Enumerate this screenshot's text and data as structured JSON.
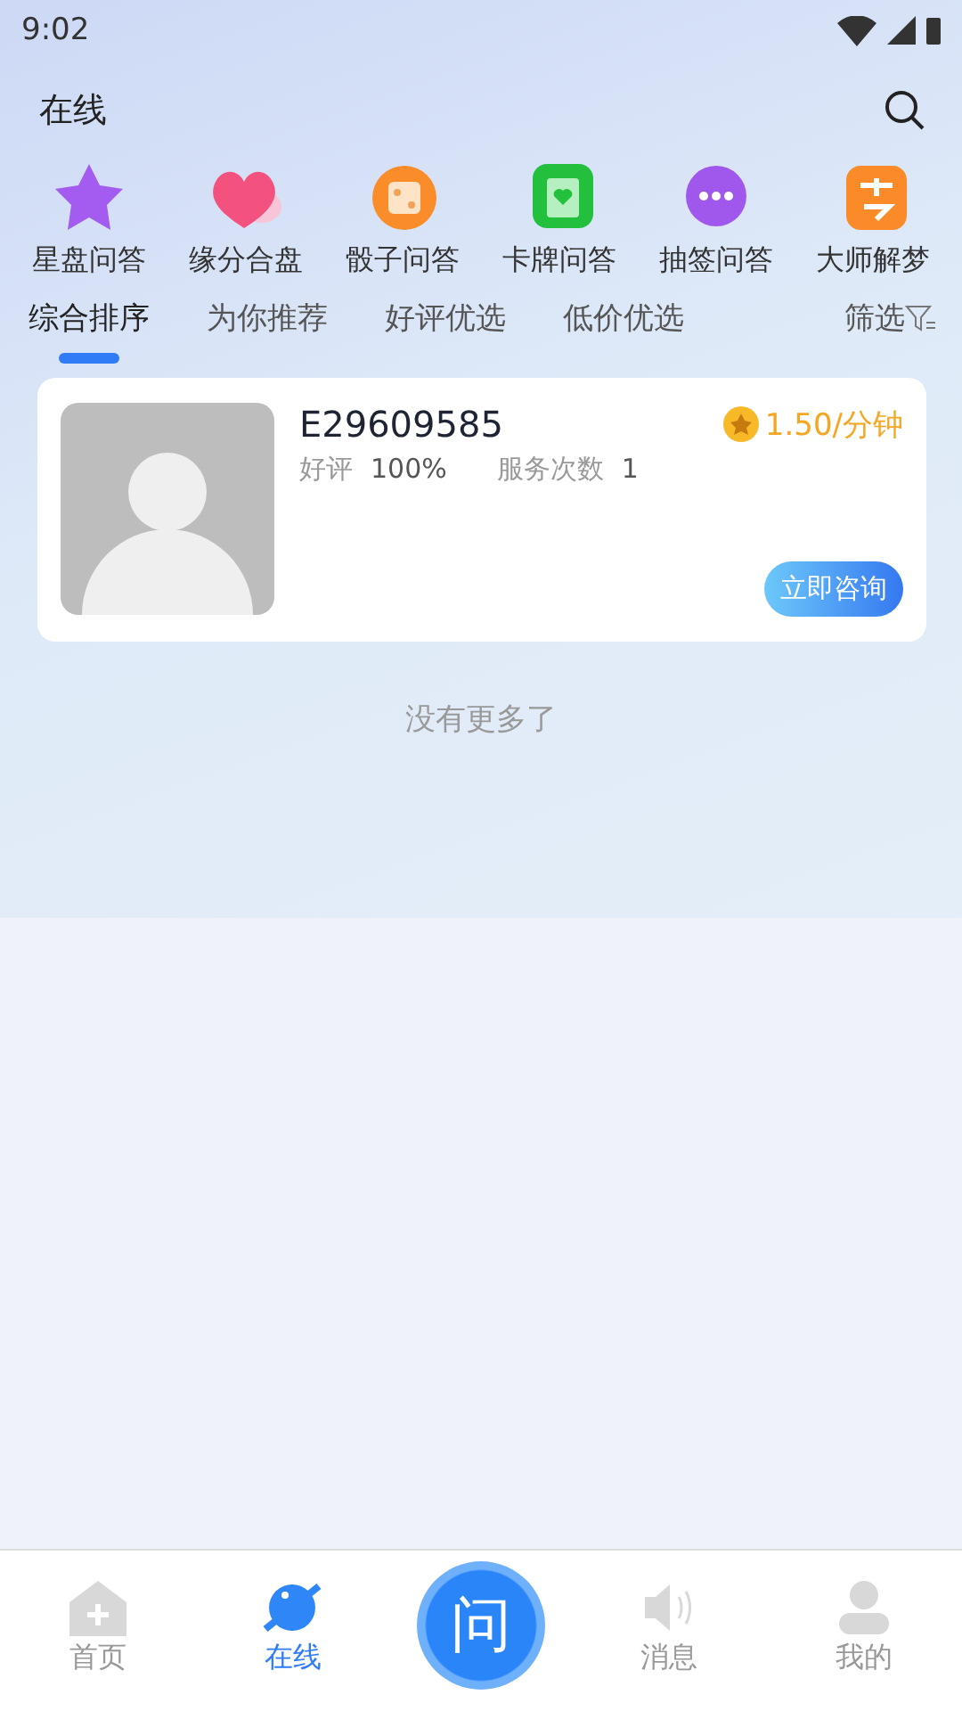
{
  "status_bar": {
    "time": "9:02"
  },
  "header": {
    "title": "在线"
  },
  "categories": [
    {
      "label": "星盘问答"
    },
    {
      "label": "缘分合盘"
    },
    {
      "label": "骰子问答"
    },
    {
      "label": "卡牌问答"
    },
    {
      "label": "抽签问答"
    },
    {
      "label": "大师解梦"
    }
  ],
  "sort_tabs": [
    {
      "label": "综合排序",
      "selected": true
    },
    {
      "label": "为你推荐",
      "selected": false
    },
    {
      "label": "好评优选",
      "selected": false
    },
    {
      "label": "低价优选",
      "selected": false
    }
  ],
  "filter": {
    "label": "筛选"
  },
  "cards": [
    {
      "name": "E29609585",
      "price": "1.50/分钟",
      "rating_label": "好评",
      "rating": "100%",
      "count_label": "服务次数",
      "count": "1",
      "action": "立即咨询"
    }
  ],
  "end_note": "没有更多了",
  "bottom_nav": [
    {
      "label": "首页",
      "selected": false
    },
    {
      "label": "在线",
      "selected": true
    },
    {
      "kind": "center",
      "label": "问"
    },
    {
      "label": "消息",
      "selected": false
    },
    {
      "label": "我的",
      "selected": false
    }
  ]
}
